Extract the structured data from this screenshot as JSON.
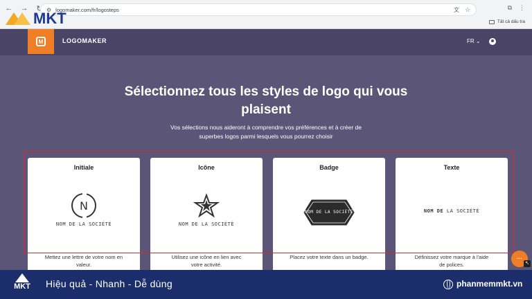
{
  "browser": {
    "url": "logomaker.com/fr/logosteps",
    "bookmark_label": "Tất cả dấu tra"
  },
  "overlay_logo": {
    "word": "MKT"
  },
  "header": {
    "brand": "LOGOMAKER",
    "language": "FR",
    "accent_color": "#f07e26"
  },
  "main": {
    "title_line1": "Sélectionnez tous les styles de logo qui vous",
    "title_line2": "plaisent",
    "subtitle_line1": "Vos sélections nous aideront à comprendre vos préférences et à créer de",
    "subtitle_line2": "superbes logos parmi lesquels vous pourrez choisir"
  },
  "cards": [
    {
      "title": "Initiale",
      "letter": "N",
      "company": "NOM DE LA SOCIÉTÉ",
      "desc_line1": "Mettez une lettre de votre nom en",
      "desc_line2": "valeur."
    },
    {
      "title": "Icône",
      "company": "NOM DE LA SOCIÉTÉ",
      "desc_line1": "Utilisez une icône en lien avec",
      "desc_line2": "votre activité."
    },
    {
      "title": "Badge",
      "company": "NOM DE LA SOCIÉTÉ",
      "desc_line1": "Placez votre texte dans un badge.",
      "desc_line2": ""
    },
    {
      "title": "Texte",
      "company_bold": "NOM DE",
      "company_rest": " LA SOCIÉTÉ",
      "desc_line1": "Définissez votre marque à l'aide",
      "desc_line2": "de polices."
    }
  ],
  "banner": {
    "word": "MKT",
    "slogan": "Hiệu quả - Nhanh  - Dễ dùng",
    "site": "phanmemmkt.vn"
  }
}
